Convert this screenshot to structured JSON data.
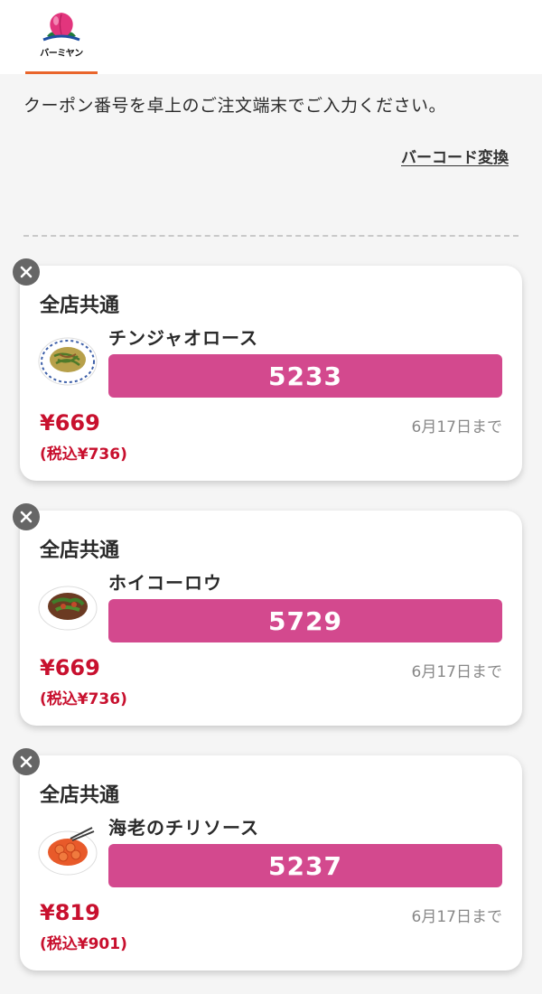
{
  "header": {
    "logo_text": "バーミヤン"
  },
  "intro_text": "クーポン番号を卓上のご注文端末でご入力ください。",
  "barcode_link": "バーコード変換",
  "coupons": [
    {
      "scope": "全店共通",
      "name": "チンジャオロース",
      "code": "5233",
      "price": "¥669",
      "price_tax": "(税込¥736)",
      "expiry": "6月17日まで"
    },
    {
      "scope": "全店共通",
      "name": "ホイコーロウ",
      "code": "5729",
      "price": "¥669",
      "price_tax": "(税込¥736)",
      "expiry": "6月17日まで"
    },
    {
      "scope": "全店共通",
      "name": "海老のチリソース",
      "code": "5237",
      "price": "¥819",
      "price_tax": "(税込¥901)",
      "expiry": "6月17日まで"
    }
  ],
  "colors": {
    "accent_tab": "#e9652b",
    "code_bar": "#d3498e",
    "price": "#c8102e"
  },
  "icons": {
    "close": "close-icon",
    "logo": "peach-logo-icon"
  }
}
